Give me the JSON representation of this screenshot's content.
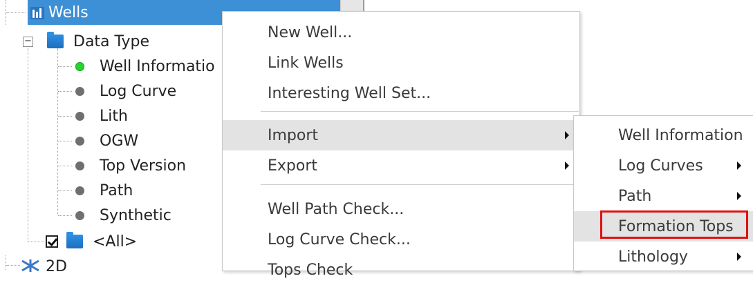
{
  "tree": {
    "root_label": "Wells",
    "data_type_label": "Data Type",
    "items": [
      {
        "label": "Well Informatio",
        "status": "active"
      },
      {
        "label": "Log Curve",
        "status": "inactive"
      },
      {
        "label": "Lith",
        "status": "inactive"
      },
      {
        "label": "OGW",
        "status": "inactive"
      },
      {
        "label": "Top Version",
        "status": "inactive"
      },
      {
        "label": "Path",
        "status": "inactive"
      },
      {
        "label": "Synthetic",
        "status": "inactive"
      }
    ],
    "all_label": "<All>",
    "next_root_label": "2D",
    "selected_color": "#3d8fd6"
  },
  "context_menu": {
    "items": [
      {
        "label": "New Well..."
      },
      {
        "label": "Link Wells"
      },
      {
        "label": "Interesting Well Set..."
      },
      {
        "label": "Import",
        "submenu": true,
        "highlighted": true
      },
      {
        "label": "Export",
        "submenu": true
      },
      {
        "label": "Well Path Check..."
      },
      {
        "label": "Log Curve Check..."
      },
      {
        "label": "Tops Check"
      }
    ]
  },
  "import_submenu": {
    "items": [
      {
        "label": "Well Information"
      },
      {
        "label": "Log Curves",
        "submenu": true
      },
      {
        "label": "Path",
        "submenu": true
      },
      {
        "label": "Formation Tops",
        "highlighted": true,
        "annotated": true
      },
      {
        "label": "Lithology",
        "submenu": true
      }
    ],
    "annotation_color": "#e01010"
  }
}
